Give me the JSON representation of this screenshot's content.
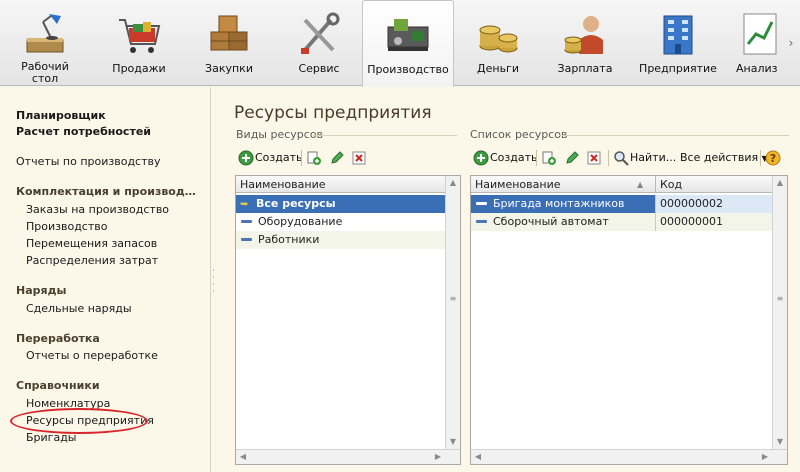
{
  "ribbon": {
    "items": [
      {
        "label": "Рабочий\nстол",
        "icon": "desk-lamp-icon"
      },
      {
        "label": "Продажи",
        "icon": "shopping-cart-icon"
      },
      {
        "label": "Закупки",
        "icon": "boxes-icon"
      },
      {
        "label": "Сервис",
        "icon": "tools-icon"
      },
      {
        "label": "Производство",
        "icon": "factory-machine-icon",
        "active": true
      },
      {
        "label": "Деньги",
        "icon": "coins-icon"
      },
      {
        "label": "Зарплата",
        "icon": "worker-icon"
      },
      {
        "label": "Предприятие",
        "icon": "building-icon"
      },
      {
        "label": "Анализ",
        "icon": "chart-icon"
      }
    ]
  },
  "left": {
    "top_links": [
      "Планировщик",
      "Расчет потребностей"
    ],
    "reports": "Отчеты по производству",
    "groups": [
      {
        "title": "Комплектация и производ…",
        "items": [
          "Заказы на производство",
          "Производство",
          "Перемещения запасов",
          "Распределения затрат"
        ]
      },
      {
        "title": "Наряды",
        "items": [
          "Сдельные наряды"
        ]
      },
      {
        "title": "Переработка",
        "items": [
          "Отчеты о переработке"
        ]
      },
      {
        "title": "Справочники",
        "items": [
          "Номенклатура",
          "Ресурсы предприятия",
          "Бригады"
        ]
      }
    ]
  },
  "main": {
    "title": "Ресурсы предприятия",
    "left_section": {
      "label": "Виды ресурсов",
      "create": "Создать",
      "column": "Наименование",
      "rows": [
        "Все ресурсы",
        "Оборудование",
        "Работники"
      ]
    },
    "right_section": {
      "label": "Список ресурсов",
      "create": "Создать",
      "find": "Найти...",
      "all_actions": "Все действия",
      "columns": [
        "Наименование",
        "Код"
      ],
      "rows": [
        {
          "name": "Бригада монтажников",
          "code": "000000002"
        },
        {
          "name": "Сборочный автомат",
          "code": "000000001"
        }
      ]
    }
  },
  "colors": {
    "selection": "#3b6fb5",
    "panel_bg": "#fbf8ea",
    "highlight": "#d8262b"
  }
}
